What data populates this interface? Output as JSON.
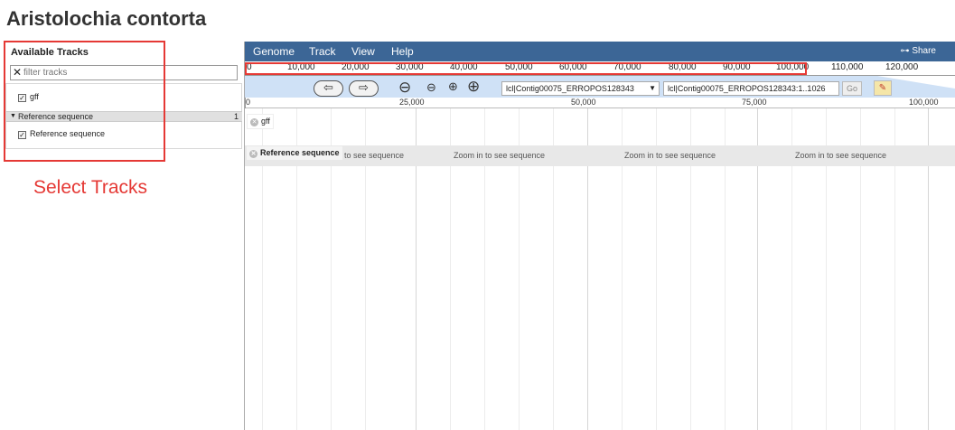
{
  "page": {
    "title": "Aristolochia contorta"
  },
  "sidebar": {
    "title": "Available Tracks",
    "filter_placeholder": "filter tracks",
    "tracks": [
      {
        "label": "gff",
        "checked": true
      }
    ],
    "category": {
      "name": "Reference sequence",
      "count": "1"
    },
    "category_tracks": [
      {
        "label": "Reference sequence",
        "checked": true
      }
    ]
  },
  "annotation": {
    "label": "Select Tracks",
    "color": "#e53935"
  },
  "menu": {
    "items": [
      "Genome",
      "Track",
      "View",
      "Help"
    ],
    "share_label": "Share"
  },
  "overview": {
    "ticks": [
      "0",
      "10,000",
      "20,000",
      "30,000",
      "40,000",
      "50,000",
      "60,000",
      "70,000",
      "80,000",
      "90,000",
      "100,000",
      "110,000",
      "120,000"
    ]
  },
  "navigation": {
    "ref_select_value": "lcl|Contig00075_ERROPOS128343",
    "location_value": "lcl|Contig00075_ERROPOS128343:1..1026",
    "go_label": "Go"
  },
  "ruler": {
    "ticks": [
      "0",
      "25,000",
      "50,000",
      "75,000",
      "100,000"
    ]
  },
  "tracks_view": {
    "gff_label": "gff",
    "reference_label": "Reference sequence",
    "zoom_message": "Zoom in to see sequence"
  },
  "colors": {
    "menubar": "#3c6696",
    "navbar": "#cfe1f6",
    "highlight": "#e53935"
  }
}
